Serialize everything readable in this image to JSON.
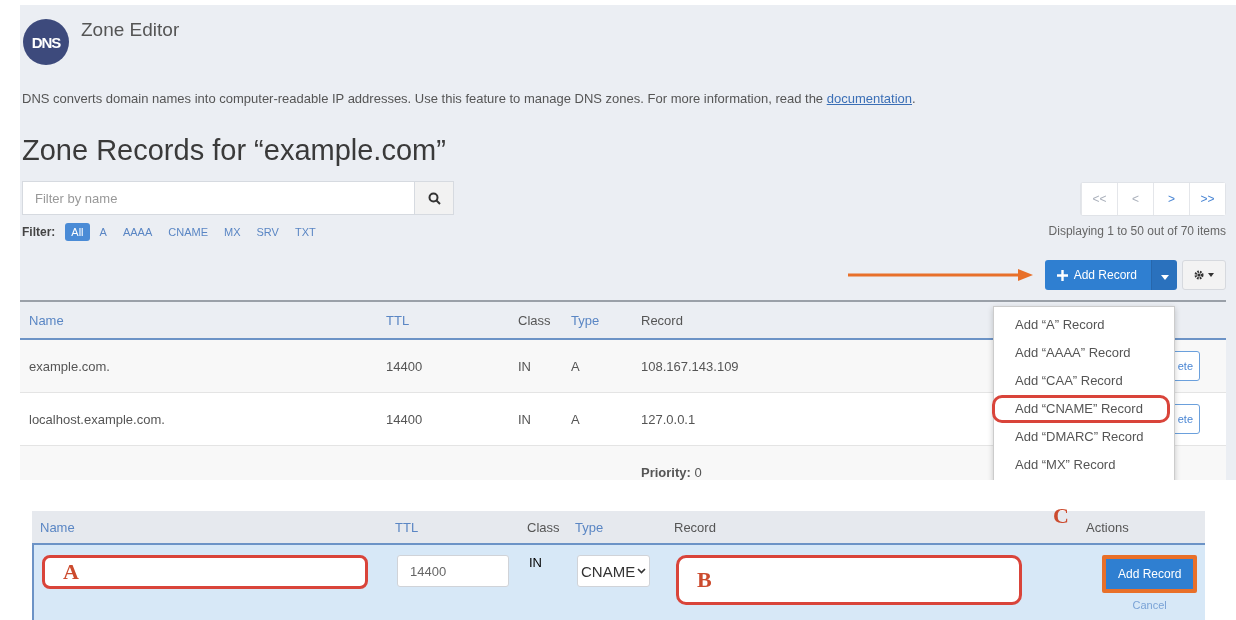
{
  "header": {
    "logo_text": "DNS",
    "title": "Zone Editor"
  },
  "description": {
    "text": "DNS converts domain names into computer-readable IP addresses. Use this feature to manage DNS zones. For more information, read the",
    "link": "documentation",
    "end": "."
  },
  "heading": "Zone Records for “example.com”",
  "search": {
    "placeholder": "Filter by name"
  },
  "filter": {
    "label": "Filter:",
    "options": [
      {
        "label": "All",
        "selected": true
      },
      {
        "label": "A",
        "selected": false
      },
      {
        "label": "AAAA",
        "selected": false
      },
      {
        "label": "CNAME",
        "selected": false
      },
      {
        "label": "MX",
        "selected": false
      },
      {
        "label": "SRV",
        "selected": false
      },
      {
        "label": "TXT",
        "selected": false
      }
    ]
  },
  "pagination": {
    "buttons": [
      {
        "label": "<<",
        "disabled": true
      },
      {
        "label": "<",
        "disabled": true
      },
      {
        "label": ">",
        "disabled": false
      },
      {
        "label": ">>",
        "disabled": false
      }
    ],
    "summary": "Displaying 1 to 50 out of 70 items"
  },
  "toolbar": {
    "add_button": "Add Record",
    "arrow_callout": true
  },
  "menu": {
    "items": [
      {
        "label": "Add “A” Record",
        "circled": false
      },
      {
        "label": "Add “AAAA” Record",
        "circled": false
      },
      {
        "label": "Add “CAA” Record",
        "circled": false
      },
      {
        "label": "Add “CNAME” Record",
        "circled": true
      },
      {
        "label": "Add “DMARC” Record",
        "circled": false
      },
      {
        "label": "Add “MX” Record",
        "circled": false
      }
    ]
  },
  "table": {
    "columns": [
      {
        "label": "Name",
        "sortable": true
      },
      {
        "label": "TTL",
        "sortable": true
      },
      {
        "label": "Class",
        "sortable": false
      },
      {
        "label": "Type",
        "sortable": true
      },
      {
        "label": "Record",
        "sortable": false
      }
    ],
    "rows": [
      {
        "name": "example.com.",
        "ttl": "14400",
        "class": "IN",
        "type": "A",
        "record": "108.167.143.109",
        "action": "ete"
      },
      {
        "name": "localhost.example.com.",
        "ttl": "14400",
        "class": "IN",
        "type": "A",
        "record": "127.0.0.1",
        "action": "ete"
      },
      {
        "record": "**Priority:** 0"
      }
    ]
  },
  "editor": {
    "columns": [
      {
        "label": "Name",
        "sortable": true
      },
      {
        "label": "TTL",
        "sortable": true
      },
      {
        "label": "Class",
        "sortable": false
      },
      {
        "label": "Type",
        "sortable": true
      },
      {
        "label": "Record",
        "sortable": false
      },
      {
        "label": "Actions",
        "sortable": false
      }
    ],
    "ttl": "14400",
    "class": "IN",
    "type": "CNAME",
    "submit": "Add Record",
    "cancel": "Cancel",
    "callouts": {
      "name": "A",
      "record": "B",
      "actions": "C"
    },
    "circled": {
      "name": true,
      "record": true,
      "submit": true
    }
  }
}
